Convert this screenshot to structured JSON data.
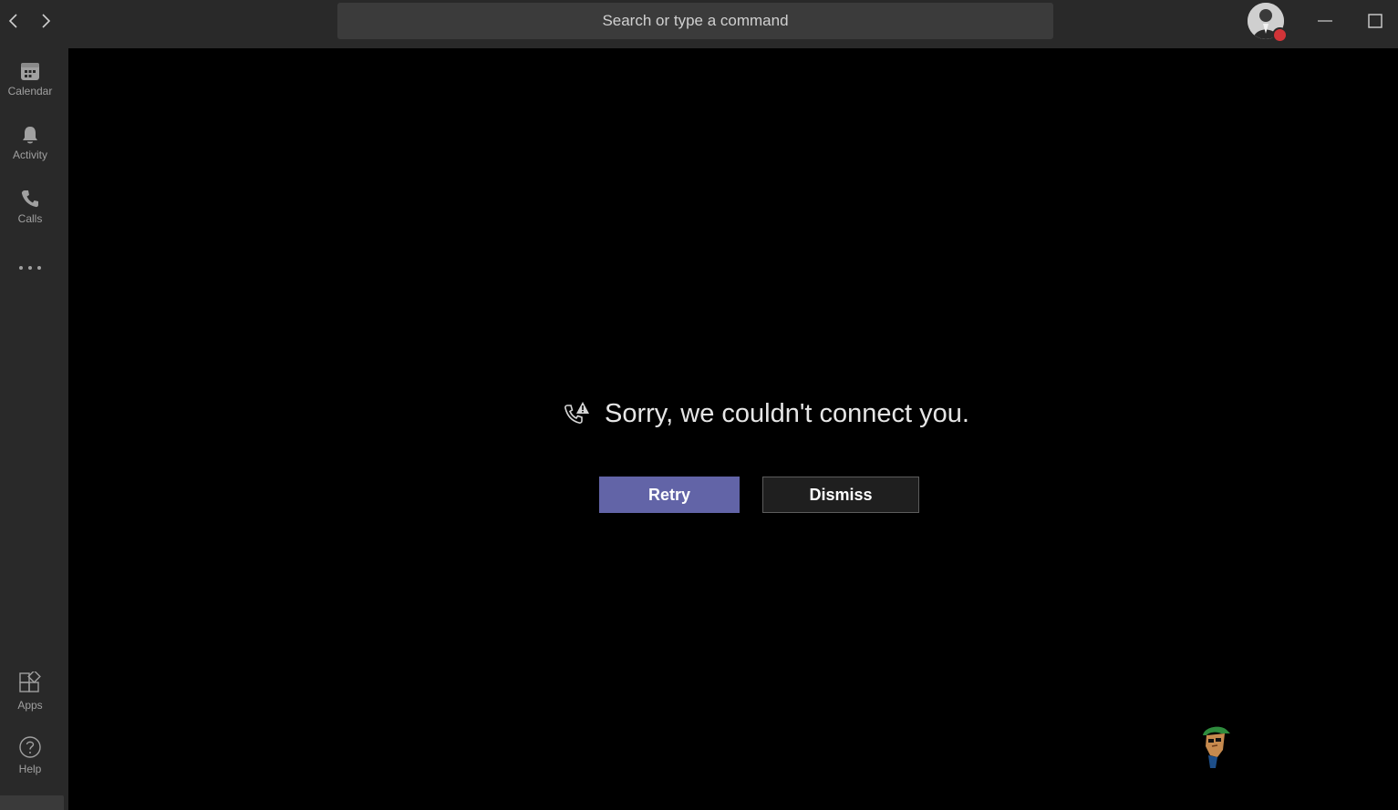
{
  "titlebar": {
    "search_placeholder": "Search or type a command",
    "back_icon": "chevron-left-icon",
    "forward_icon": "chevron-right-icon"
  },
  "rail": {
    "items": [
      {
        "label": "Calendar",
        "icon": "calendar-icon"
      },
      {
        "label": "Activity",
        "icon": "bell-icon"
      },
      {
        "label": "Calls",
        "icon": "phone-icon"
      },
      {
        "label": "",
        "icon": "more-icon"
      }
    ],
    "bottom": [
      {
        "label": "Apps",
        "icon": "apps-icon"
      },
      {
        "label": "Help",
        "icon": "help-icon"
      }
    ]
  },
  "call": {
    "message": "Sorry, we couldn't connect you.",
    "retry_label": "Retry",
    "dismiss_label": "Dismiss"
  },
  "colors": {
    "accent": "#6264a7",
    "presence_busy": "#d13438"
  }
}
